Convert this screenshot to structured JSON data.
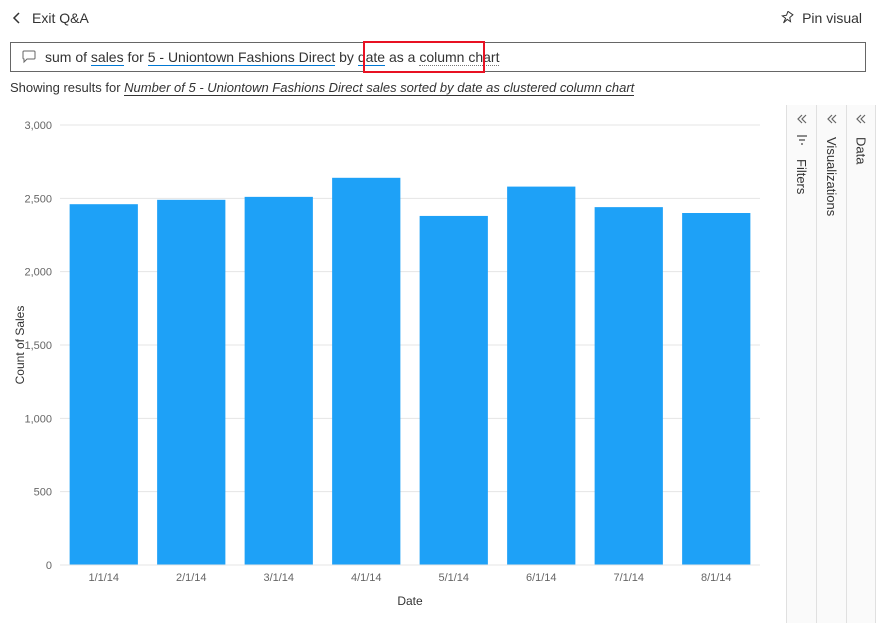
{
  "topbar": {
    "exit_label": "Exit Q&A",
    "pin_label": "Pin visual"
  },
  "query": {
    "prefix": "sum of ",
    "term_sales": "sales",
    "for": " for ",
    "term_store": "5 - Uniontown Fashions Direct",
    "by": " by ",
    "term_date": "date",
    "as_a": " as a ",
    "term_chart": "column chart"
  },
  "result_caption": {
    "prefix": "Showing results for ",
    "italic_part": "Number of 5 - Uniontown Fashions Direct sales sorted by date as clustered column chart"
  },
  "panes": {
    "filters": "Filters",
    "visualizations": "Visualizations",
    "data": "Data"
  },
  "chart_data": {
    "type": "bar",
    "categories": [
      "1/1/14",
      "2/1/14",
      "3/1/14",
      "4/1/14",
      "5/1/14",
      "6/1/14",
      "7/1/14",
      "8/1/14"
    ],
    "values": [
      2460,
      2490,
      2510,
      2640,
      2380,
      2580,
      2440,
      2400
    ],
    "ylabel": "Count of Sales",
    "xlabel": "Date",
    "ylim": [
      0,
      3000
    ],
    "yticks": [
      0,
      500,
      1000,
      1500,
      2000,
      2500,
      3000
    ]
  }
}
